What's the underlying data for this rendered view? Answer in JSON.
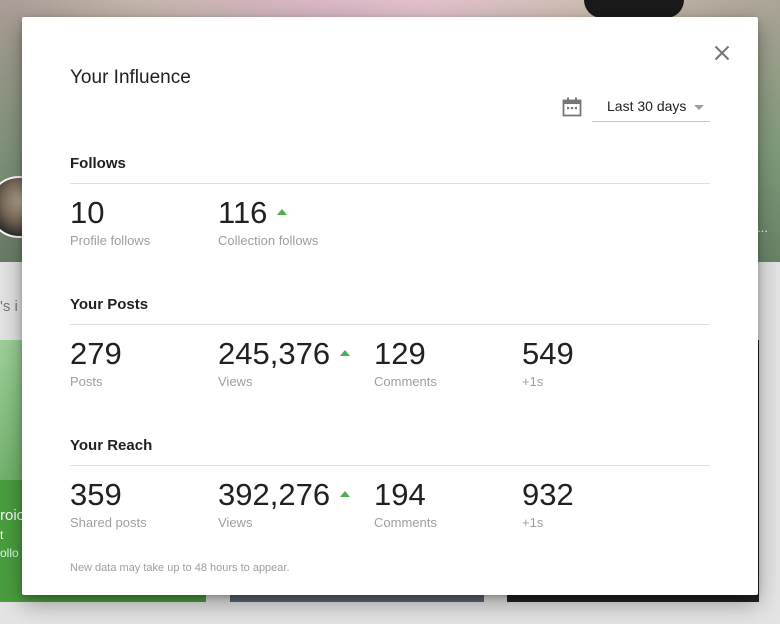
{
  "background": {
    "section_text": "'s i",
    "card_left": {
      "line1": "roic",
      "line2": "t",
      "line3": "ollo"
    },
    "ellipsis": "..."
  },
  "modal": {
    "title": "Your Influence",
    "date_range": {
      "icon": "calendar-icon",
      "selected": "Last 30 days"
    },
    "close_icon": "close-icon",
    "sections": [
      {
        "title": "Follows",
        "stats": [
          {
            "value": "10",
            "label": "Profile follows",
            "trend": "none"
          },
          {
            "value": "116",
            "label": "Collection follows",
            "trend": "up"
          }
        ]
      },
      {
        "title": "Your Posts",
        "stats": [
          {
            "value": "279",
            "label": "Posts",
            "trend": "none"
          },
          {
            "value": "245,376",
            "label": "Views",
            "trend": "up"
          },
          {
            "value": "129",
            "label": "Comments",
            "trend": "none"
          },
          {
            "value": "549",
            "label": "+1s",
            "trend": "none"
          }
        ]
      },
      {
        "title": "Your Reach",
        "stats": [
          {
            "value": "359",
            "label": "Shared posts",
            "trend": "none"
          },
          {
            "value": "392,276",
            "label": "Views",
            "trend": "up"
          },
          {
            "value": "194",
            "label": "Comments",
            "trend": "none"
          },
          {
            "value": "932",
            "label": "+1s",
            "trend": "none"
          }
        ]
      }
    ],
    "footnote": "New data may take up to 48 hours to appear."
  },
  "colors": {
    "trend_up": "#4caf50",
    "text_primary": "#212121",
    "text_secondary": "#9e9e9e"
  }
}
